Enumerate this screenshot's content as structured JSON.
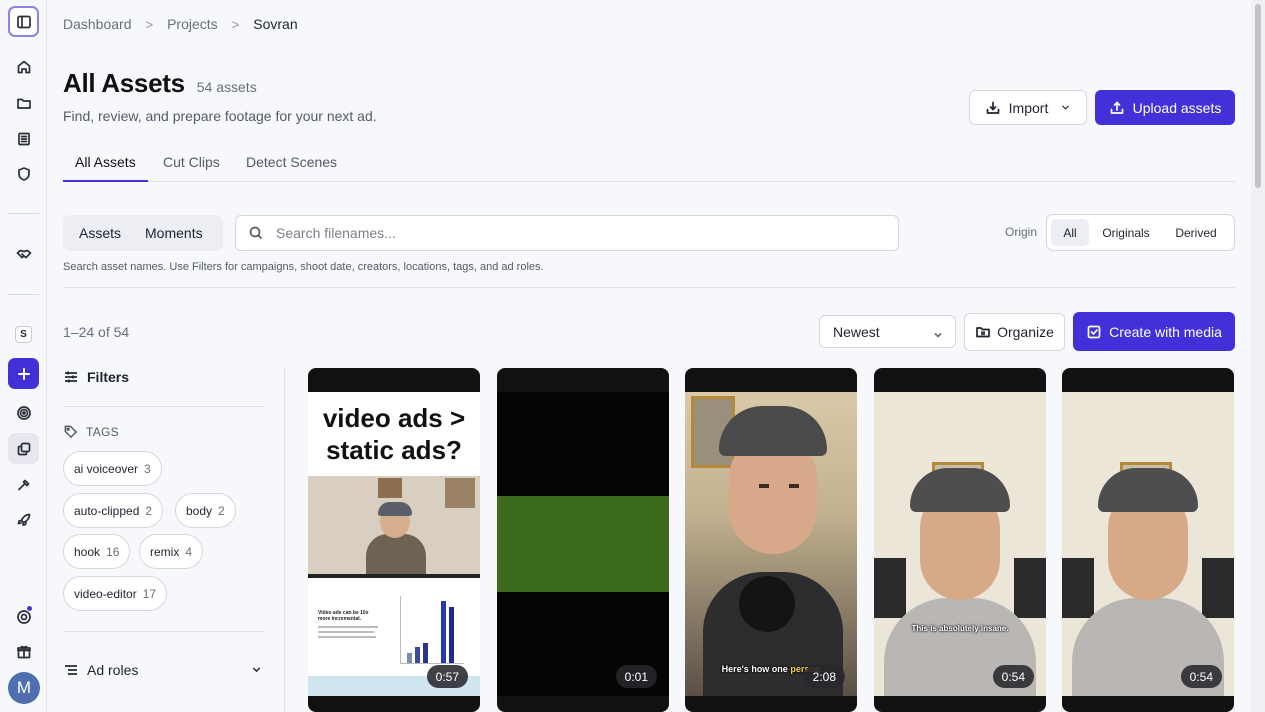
{
  "breadcrumb": [
    "Dashboard",
    "Projects",
    "Sovran"
  ],
  "header": {
    "title": "All Assets",
    "count": "54 assets",
    "subtitle": "Find, review, and prepare footage for your next ad.",
    "import_label": "Import",
    "upload_label": "Upload assets"
  },
  "tabs": [
    "All Assets",
    "Cut Clips",
    "Detect Scenes"
  ],
  "view_toggle": [
    "Assets",
    "Moments"
  ],
  "search": {
    "placeholder": "Search filenames...",
    "help": "Search asset names. Use Filters for campaigns, shoot date, creators, locations, tags, and ad roles."
  },
  "origin": {
    "label": "Origin",
    "options": [
      "All",
      "Originals",
      "Derived"
    ],
    "selected": "All"
  },
  "results": {
    "range": "1–24 of 54",
    "sort": "Newest",
    "organize_label": "Organize",
    "create_label": "Create with media"
  },
  "filters": {
    "title": "Filters",
    "tags_heading": "TAGS",
    "tags": [
      {
        "name": "ai voiceover",
        "count": "3"
      },
      {
        "name": "auto-clipped",
        "count": "2"
      },
      {
        "name": "body",
        "count": "2"
      },
      {
        "name": "hook",
        "count": "16"
      },
      {
        "name": "remix",
        "count": "4"
      },
      {
        "name": "video-editor",
        "count": "17"
      }
    ],
    "ad_roles_label": "Ad roles"
  },
  "rail": {
    "avatar_initial": "M",
    "workspace_badge": "S"
  },
  "assets": [
    {
      "duration": "0:57",
      "overlay_text": "video ads > static ads?",
      "slide_title": "Video ads can be 10x more incremental.",
      "caption": ""
    },
    {
      "duration": "0:01",
      "overlay_text": "",
      "slide_title": "",
      "caption": ""
    },
    {
      "duration": "2:08",
      "overlay_text": "",
      "slide_title": "",
      "caption": "Here's how one",
      "caption_highlight": "person"
    },
    {
      "duration": "0:54",
      "overlay_text": "",
      "slide_title": "",
      "caption": "This is absolutely insane."
    },
    {
      "duration": "0:54",
      "overlay_text": "",
      "slide_title": "",
      "caption": ""
    }
  ],
  "colors": {
    "accent": "#4231d9",
    "green_frame": "#3d6b1c"
  }
}
